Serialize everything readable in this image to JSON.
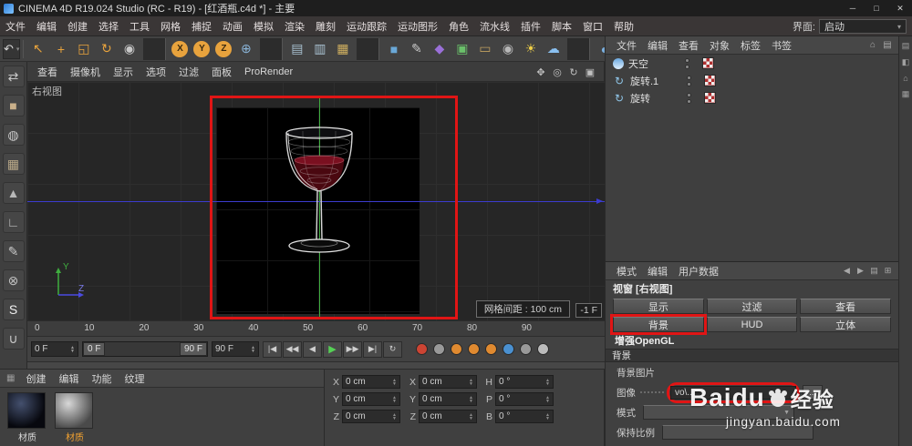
{
  "colors": {
    "annotation_red": "#e01515",
    "accent_orange": "#e8a33d",
    "axis_green": "#3fae3f",
    "axis_blue": "#3c3ccf",
    "play_green": "#55d055"
  },
  "title_bar": {
    "title": "CINEMA 4D R19.024 Studio (RC - R19) - [红酒瓶.c4d *] - 主要",
    "minimize": "─",
    "maximize": "□",
    "close": "✕"
  },
  "menu_bar": {
    "items": [
      "文件",
      "编辑",
      "创建",
      "选择",
      "工具",
      "网格",
      "捕捉",
      "动画",
      "模拟",
      "渲染",
      "雕刻",
      "运动跟踪",
      "运动图形",
      "角色",
      "流水线",
      "插件",
      "脚本",
      "窗口",
      "帮助"
    ],
    "interface_label": "界面:",
    "interface_value": "启动",
    "caret": "▾"
  },
  "main_toolbar": {
    "undo_glyph": "↶",
    "icons": [
      {
        "name": "live-selection-icon",
        "glyph": "↖",
        "color": "#e8a33d"
      },
      {
        "name": "move-tool-icon",
        "glyph": "+",
        "color": "#e8a33d"
      },
      {
        "name": "scale-tool-icon",
        "glyph": "◱",
        "color": "#e8a33d"
      },
      {
        "name": "rotate-tool-icon",
        "glyph": "↻",
        "color": "#e8a33d"
      },
      {
        "name": "last-tool-icon",
        "glyph": "◉",
        "color": "#c8c8c8"
      },
      {
        "sep": true
      },
      {
        "name": "lock-x-axis-icon",
        "glyph": "X",
        "color": "#3a2a10",
        "bg": "#e8a33d"
      },
      {
        "name": "lock-y-axis-icon",
        "glyph": "Y",
        "color": "#3a2a10",
        "bg": "#e8a33d"
      },
      {
        "name": "lock-z-axis-icon",
        "glyph": "Z",
        "color": "#3a2a10",
        "bg": "#e8a33d"
      },
      {
        "name": "coordinate-system-icon",
        "glyph": "⊕",
        "color": "#8ab4d8"
      },
      {
        "sep": true
      },
      {
        "name": "render-view-icon",
        "glyph": "▤",
        "color": "#a8c0d0"
      },
      {
        "name": "render-picture-viewer-icon",
        "glyph": "▥",
        "color": "#a8c0d0"
      },
      {
        "name": "render-settings-icon",
        "glyph": "▦",
        "color": "#d0b060"
      },
      {
        "sep": true
      },
      {
        "name": "add-cube-icon",
        "glyph": "■",
        "color": "#6aa8d8"
      },
      {
        "name": "spline-pen-icon",
        "glyph": "✎",
        "color": "#c8c8c8"
      },
      {
        "name": "subdivision-surface-icon",
        "glyph": "◆",
        "color": "#9a70d8"
      },
      {
        "name": "array-generator-icon",
        "glyph": "▣",
        "color": "#6ac06a"
      },
      {
        "name": "floor-object-icon",
        "glyph": "▭",
        "color": "#c0a060"
      },
      {
        "name": "camera-object-icon",
        "glyph": "◉",
        "color": "#b8b8b8"
      },
      {
        "name": "light-object-icon",
        "glyph": "☀",
        "color": "#f0d048"
      },
      {
        "name": "sky-object-icon",
        "glyph": "☁",
        "color": "#8ac0f0"
      },
      {
        "sep": true
      },
      {
        "name": "display-mode-icon",
        "glyph": "◐",
        "color": "#7ab0e0"
      },
      {
        "name": "layout-icon",
        "glyph": "▦",
        "color": "#c8c8c8"
      }
    ]
  },
  "left_toolbar": {
    "icons": [
      {
        "name": "convert-selection-icon",
        "glyph": "⇄",
        "color": "#c8c8c8"
      },
      {
        "name": "cube-primitive-icon",
        "glyph": "■",
        "color": "#c9b08a"
      },
      {
        "name": "checker-sphere-icon",
        "glyph": "◍",
        "color": "#c8c8c8"
      },
      {
        "name": "stacked-cubes-icon",
        "glyph": "▦",
        "color": "#b8a888"
      },
      {
        "name": "cone-primitive-icon",
        "glyph": "▲",
        "color": "#b8b8b8"
      },
      {
        "name": "l-extrude-icon",
        "glyph": "∟",
        "color": "#c0c0c0"
      },
      {
        "name": "spline-pen-icon",
        "glyph": "✎",
        "color": "#c8c8c8"
      },
      {
        "name": "axis-lock-icon",
        "glyph": "⊗",
        "color": "#c0c0c0"
      },
      {
        "name": "snap-badge-icon",
        "glyph": "S",
        "color": "#f0f0f0"
      },
      {
        "name": "magnet-icon",
        "glyph": "∪",
        "color": "#c8c8c8"
      }
    ]
  },
  "viewport": {
    "label": "右视图",
    "menu": [
      "查看",
      "摄像机",
      "显示",
      "选项",
      "过滤",
      "面板",
      "ProRender"
    ],
    "corner_icons": [
      {
        "name": "pan-view-icon",
        "glyph": "✥",
        "color": "#c0c0c0"
      },
      {
        "name": "zoom-view-icon",
        "glyph": "◎",
        "color": "#c0c0c0"
      },
      {
        "name": "rotate-view-icon",
        "glyph": "↻",
        "color": "#c0c0c0"
      },
      {
        "name": "maximize-view-icon",
        "glyph": "▣",
        "color": "#c0c0c0"
      }
    ],
    "grid_spacing": "网格间距 : 100 cm",
    "frame_badge": "-1 F",
    "axis_y_label": "Y",
    "axis_z_label": "Z"
  },
  "object_manager": {
    "menu": [
      "文件",
      "编辑",
      "查看",
      "对象",
      "标签",
      "书签"
    ],
    "header_icons": [
      {
        "name": "home-icon",
        "glyph": "⌂"
      },
      {
        "name": "filter-icon",
        "glyph": "▤"
      }
    ],
    "objects": [
      {
        "name": "天空"
      },
      {
        "name": "旋转.1"
      },
      {
        "name": "旋转"
      }
    ]
  },
  "attributes": {
    "menu": [
      "模式",
      "编辑",
      "用户数据"
    ],
    "nav_icons": [
      {
        "name": "back-icon",
        "glyph": "◀"
      },
      {
        "name": "forward-icon",
        "glyph": "▶"
      },
      {
        "name": "history-icon",
        "glyph": "▤"
      },
      {
        "name": "pin-icon",
        "glyph": "⊞"
      }
    ],
    "heading": "视窗 [右视图]",
    "tabs": [
      "显示",
      "过滤",
      "查看",
      "背景",
      "HUD",
      "立体"
    ],
    "tab_wide": "增强OpenGL",
    "active_tab": "背景",
    "section_title": "背景",
    "rows": {
      "bg_image_label": "背景图片",
      "image_label": "图像",
      "image_value": "vo\\...",
      "image_browse": "...",
      "mode_label": "模式",
      "mode_value": "",
      "keep_ratio_label": "保持比例",
      "keep_ratio_value": ""
    }
  },
  "timeline": {
    "ticks": [
      "0",
      "10",
      "20",
      "30",
      "40",
      "50",
      "60",
      "70",
      "80",
      "90"
    ],
    "current_frame": "0 F",
    "range_start": "0 F",
    "range_end": "90 F",
    "end_frame": "90 F",
    "transport": [
      {
        "name": "goto-start-button",
        "glyph": "|◀"
      },
      {
        "name": "prev-key-button",
        "glyph": "◀◀"
      },
      {
        "name": "prev-frame-button",
        "glyph": "◀"
      },
      {
        "name": "play-button",
        "glyph": "▶",
        "cls": "play"
      },
      {
        "name": "next-key-button",
        "glyph": "▶▶"
      },
      {
        "name": "goto-end-button",
        "glyph": "▶|"
      },
      {
        "name": "loop-button",
        "glyph": "↻"
      }
    ],
    "key_icons": [
      {
        "name": "record-keyframe-icon",
        "color": "#cc4433"
      },
      {
        "name": "autokey-icon",
        "color": "#999999"
      },
      {
        "name": "keyframe-position-icon",
        "color": "#e08a30"
      },
      {
        "name": "keyframe-scale-icon",
        "color": "#e08a30"
      },
      {
        "name": "keyframe-rotation-icon",
        "color": "#e08a30"
      },
      {
        "name": "keyframe-parameter-icon",
        "color": "#4a90d0"
      },
      {
        "name": "point-level-animation-icon",
        "color": "#999999"
      },
      {
        "name": "playback-options-icon",
        "color": "#bbbbbb"
      }
    ]
  },
  "materials": {
    "menu": [
      "创建",
      "编辑",
      "功能",
      "纹理"
    ],
    "items": [
      {
        "label": "材质"
      },
      {
        "label": "材质",
        "selected": true
      }
    ]
  },
  "coordinates": {
    "position": [
      {
        "label": "X",
        "value": "0 cm"
      },
      {
        "label": "Y",
        "value": "0 cm"
      },
      {
        "label": "Z",
        "value": "0 cm"
      }
    ],
    "size": [
      {
        "label": "X",
        "value": "0 cm"
      },
      {
        "label": "Y",
        "value": "0 cm"
      },
      {
        "label": "Z",
        "value": "0 cm"
      }
    ],
    "rotation": [
      {
        "label": "H",
        "value": "0 °"
      },
      {
        "label": "P",
        "value": "0 °"
      },
      {
        "label": "B",
        "value": "0 °"
      }
    ]
  },
  "watermark": {
    "brand": "Baidu",
    "brand_suffix": "经验",
    "url": "jingyan.baidu.com"
  }
}
